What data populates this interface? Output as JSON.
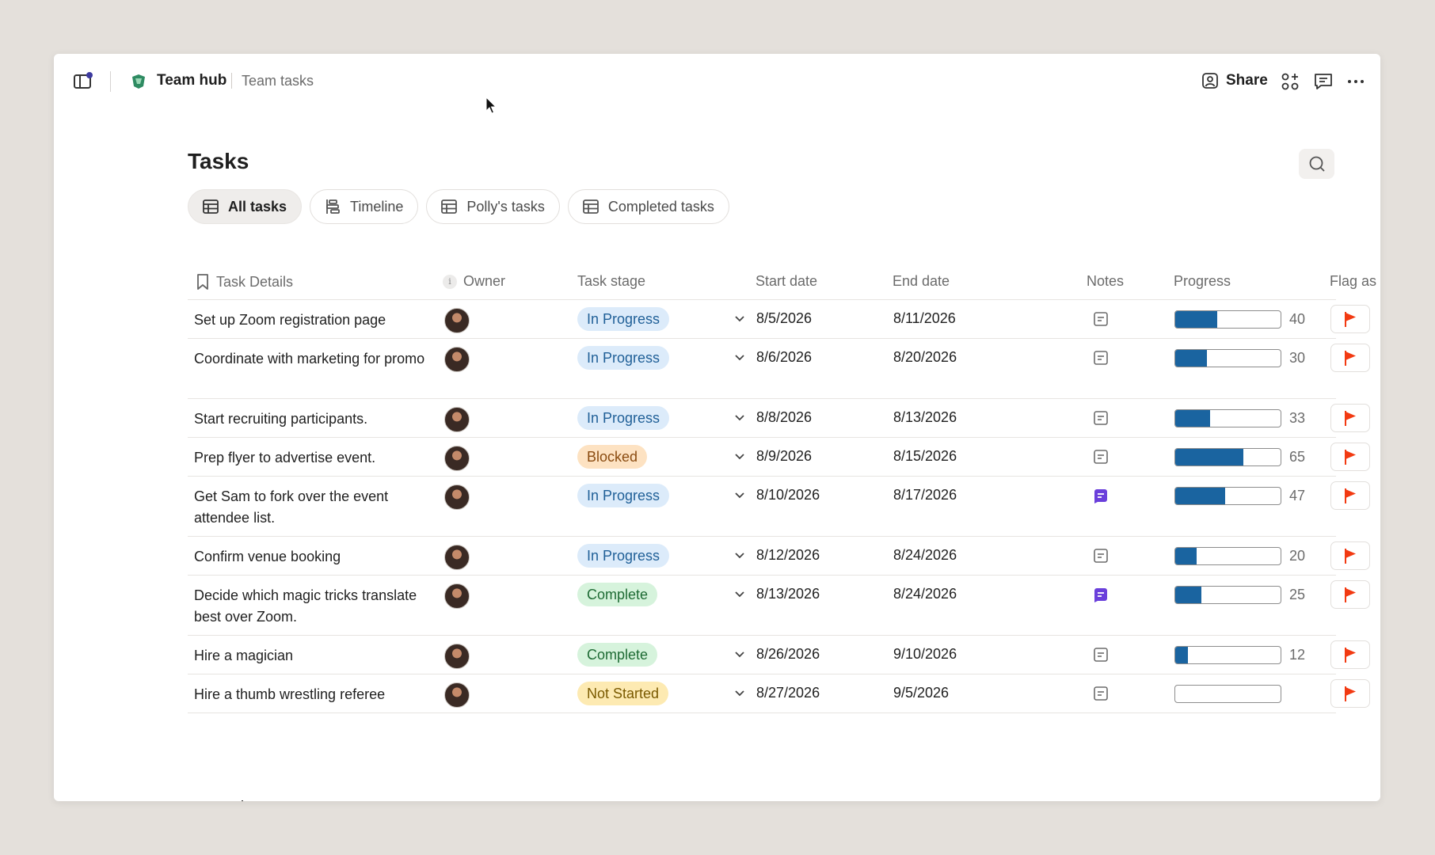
{
  "header": {
    "hub_name": "Team hub",
    "page_name": "Team tasks",
    "share_label": "Share"
  },
  "page": {
    "title": "Tasks"
  },
  "tabs": [
    {
      "label": "All tasks",
      "icon": "table-icon",
      "active": true
    },
    {
      "label": "Timeline",
      "icon": "timeline-icon",
      "active": false
    },
    {
      "label": "Polly's tasks",
      "icon": "table-icon",
      "active": false
    },
    {
      "label": "Completed tasks",
      "icon": "table-icon",
      "active": false
    }
  ],
  "columns": {
    "task": "Task Details",
    "owner": "Owner",
    "stage": "Task stage",
    "start": "Start date",
    "end": "End date",
    "notes": "Notes",
    "progress": "Progress",
    "flag": "Flag as at"
  },
  "colors": {
    "in_progress_bg": "#dcebfa",
    "in_progress_fg": "#1f5f97",
    "blocked_bg": "#fde2c2",
    "blocked_fg": "#8a4b10",
    "complete_bg": "#d6f3dc",
    "complete_fg": "#1e6b34",
    "not_started_bg": "#fdeab2",
    "not_started_fg": "#7a5a00",
    "progress_fill": "#1a64a0",
    "flag": "#f23a12",
    "note_filled": "#6a3fdb"
  },
  "rows": [
    {
      "task": "Set up Zoom registration page",
      "stage": "In Progress",
      "start": "8/5/2026",
      "end": "8/11/2026",
      "note_filled": false,
      "progress": 40,
      "progress_label": "40"
    },
    {
      "task": "Coordinate with marketing for promo",
      "stage": "In Progress",
      "start": "8/6/2026",
      "end": "8/20/2026",
      "note_filled": false,
      "progress": 30,
      "progress_label": "30"
    },
    {
      "task": "Start recruiting participants.",
      "stage": "In Progress",
      "start": "8/8/2026",
      "end": "8/13/2026",
      "note_filled": false,
      "progress": 33,
      "progress_label": "33"
    },
    {
      "task": "Prep flyer to advertise event.",
      "stage": "Blocked",
      "start": "8/9/2026",
      "end": "8/15/2026",
      "note_filled": false,
      "progress": 65,
      "progress_label": "65"
    },
    {
      "task": "Get Sam to fork over the event attendee list.",
      "stage": "In Progress",
      "start": "8/10/2026",
      "end": "8/17/2026",
      "note_filled": true,
      "progress": 47,
      "progress_label": "47"
    },
    {
      "task": "Confirm venue booking",
      "stage": "In Progress",
      "start": "8/12/2026",
      "end": "8/24/2026",
      "note_filled": false,
      "progress": 20,
      "progress_label": "20"
    },
    {
      "task": "Decide which magic tricks translate best over Zoom.",
      "stage": "Complete",
      "start": "8/13/2026",
      "end": "8/24/2026",
      "note_filled": true,
      "progress": 25,
      "progress_label": "25"
    },
    {
      "task": "Hire a magician",
      "stage": "Complete",
      "start": "8/26/2026",
      "end": "9/10/2026",
      "note_filled": false,
      "progress": 12,
      "progress_label": "12"
    },
    {
      "task": "Hire a thumb wrestling referee",
      "stage": "Not Started",
      "start": "8/27/2026",
      "end": "9/5/2026",
      "note_filled": false,
      "progress": 0,
      "progress_label": ""
    }
  ]
}
